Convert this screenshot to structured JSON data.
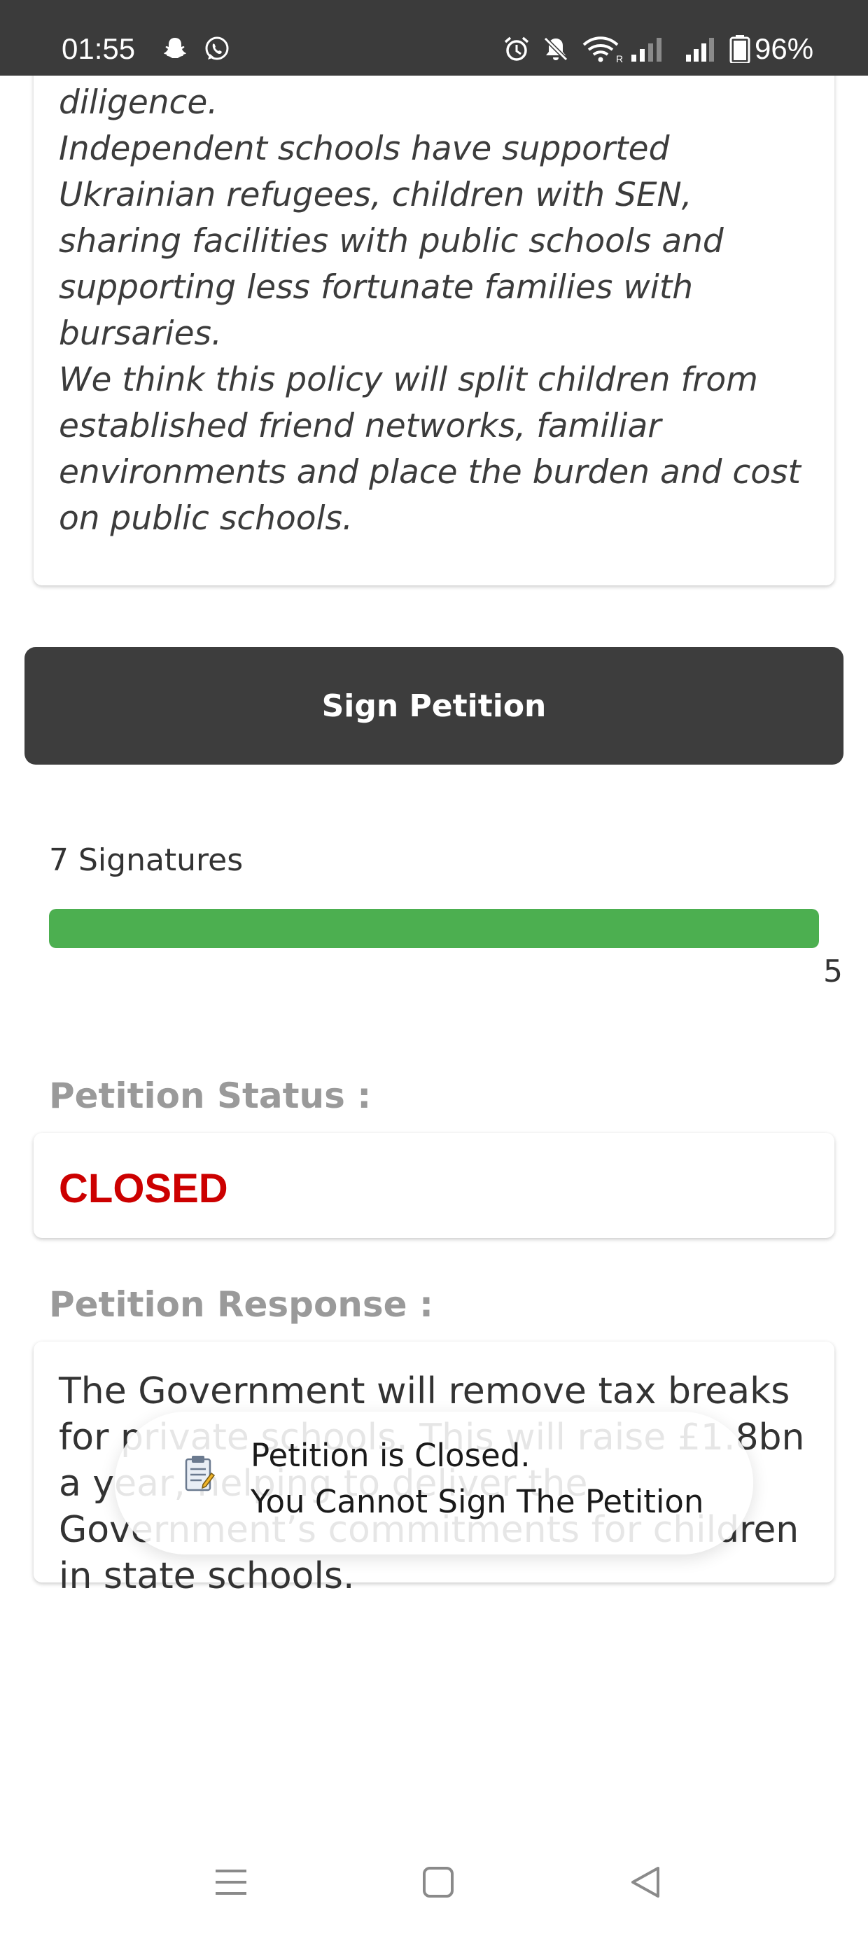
{
  "status_bar": {
    "time": "01:55",
    "battery": "96%",
    "icons": [
      "snapchat-icon",
      "whatsapp-icon",
      "alarm-icon",
      "mute-icon",
      "wifi-icon",
      "signal-icon",
      "signal-icon",
      "battery-icon"
    ]
  },
  "petition": {
    "description_lines": [
      "of independent schools and do better due diligence.",
      "Independent schools have supported Ukrainian refugees, children with SEN, sharing facilities with public schools and supporting less fortunate families with bursaries.",
      "We think this policy will split children from established friend networks, familiar environments and place the burden and cost on public schools."
    ],
    "sign_button_label": "Sign Petition",
    "signatures_label": "7 Signatures",
    "signatures_goal": "5",
    "progress_fraction": 1.0,
    "status_label": "Petition Status :",
    "status_value": "CLOSED",
    "response_label": "Petition Response :",
    "response_text": "The Government will remove tax breaks for private schools. This will raise £1.8bn a year, helping to deliver the Government’s commitments for children in state schools."
  },
  "toast": {
    "line1": "Petition is Closed.",
    "line2": "You Cannot Sign The Petition",
    "icon": "notepad-icon"
  },
  "nav_bar": {
    "icons": [
      "menu-icon",
      "home-icon",
      "back-icon"
    ]
  },
  "colors": {
    "status_bar": "#3b3b3b",
    "button": "#3d3d3d",
    "progress": "#4caf50",
    "closed": "#cc0000",
    "label": "#9a9a9a"
  }
}
